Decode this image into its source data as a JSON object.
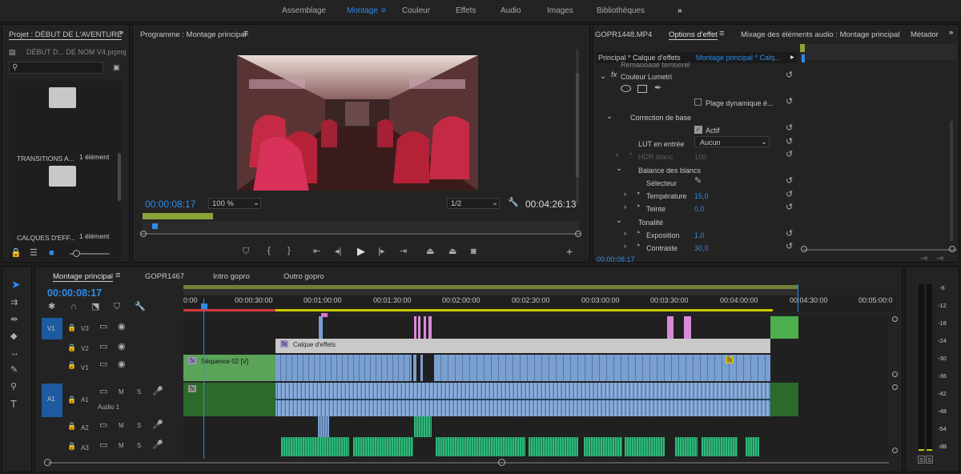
{
  "workspace": {
    "tabs": [
      "Assemblage",
      "Montage",
      "Couleur",
      "Effets",
      "Audio",
      "Images",
      "Bibliothèques"
    ],
    "more": "»"
  },
  "project": {
    "title": "Projet : DÉBUT DE L'AVENTURE",
    "file": "DÉBUT D... DE NOM V4.prproj",
    "search_placeholder": "",
    "items": [
      {
        "name": "TRANSITIONS A...",
        "count": "1 élément"
      },
      {
        "name": "CALQUES D'EFF...",
        "count": "1 élément"
      }
    ]
  },
  "program": {
    "title": "Programme : Montage principal",
    "timecode": "00:00:08:17",
    "zoom": "100 %",
    "resolution": "1/2",
    "duration": "00:04:26:13"
  },
  "source_tabs": {
    "clip": "GOPR1448.MP4",
    "effects": "Options d'effet",
    "mixer": "Mixage des éléments audio : Montage principal",
    "meta": "Métador"
  },
  "effects": {
    "master": "Principal * Calque d'effets",
    "sequence": "Montage principal * Calq...",
    "cut_header": "Remappage temporel",
    "lumetri": "Couleur Lumetri",
    "hdr_range": "Plage dynamique é...",
    "basic": "Correction de base",
    "active": "Actif",
    "lut_label": "LUT en entrée",
    "lut_value": "Aucun",
    "hdr_label": "HDR blanc",
    "hdr_value": "100",
    "wb": "Balance des blancs",
    "selector": "Sélecteur",
    "temp_label": "Température",
    "temp_value": "15,0",
    "tint_label": "Teinte",
    "tint_value": "0,0",
    "tone": "Tonalité",
    "expo_label": "Exposition",
    "expo_value": "1,0",
    "contrast_label": "Contraste",
    "contrast_value": "30,0",
    "timecode": "00:00:08:17"
  },
  "timeline": {
    "tabs": [
      "Montage principal",
      "GOPR1467",
      "Intro gopro",
      "Outro gopro"
    ],
    "timecode": "00:00:08:17",
    "ruler": [
      "0:00",
      "00:00:30:00",
      "00:01:00:00",
      "00:01:30:00",
      "00:02:00:00",
      "00:02:30:00",
      "00:03:00:00",
      "00:03:30:00",
      "00:04:00:00",
      "00:04:30:00",
      "00:05:00:0"
    ],
    "tracks": {
      "v3": "V3",
      "v2": "V2",
      "v1": "V1",
      "a1": "A1",
      "a2": "A2",
      "a3": "A3",
      "v1_target": "V1",
      "a1_target": "A1",
      "audio1": "Audio 1",
      "m": "M",
      "s": "S"
    },
    "clips": {
      "seq": "Séquence 02 [V]",
      "adj": "Calque d'effets"
    }
  },
  "meter": {
    "labels": [
      "-6",
      "-12",
      "-18",
      "-24",
      "-30",
      "-36",
      "-42",
      "-48",
      "-54",
      "dB"
    ],
    "solo": [
      "S",
      "S"
    ]
  },
  "colors": {
    "accent": "#2d8ceb",
    "green": "#5aa45a",
    "clip_blue": "#7aa0d2",
    "audio_green": "#2fb87a",
    "pink": "#e8a0e0"
  }
}
